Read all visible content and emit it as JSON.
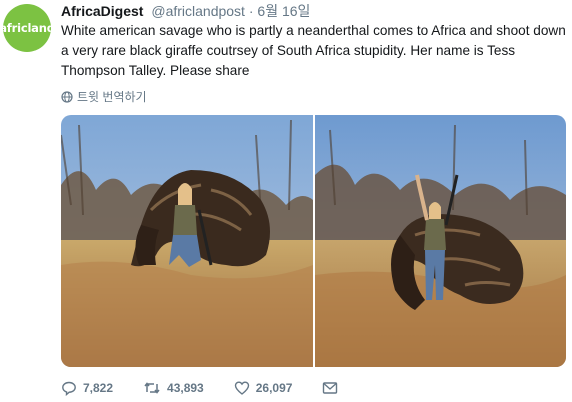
{
  "avatar": {
    "logo_text": "africland",
    "color": "#7cc242"
  },
  "tweet": {
    "display_name": "AfricaDigest",
    "handle": "@africlandpost",
    "separator": "·",
    "date": "6월 16일",
    "text": "White american savage who is partly a neanderthal comes to Africa and shoot down a very rare black giraffe coutrsey of South Africa stupidity. Her name is Tess Thompson Talley. Please share",
    "translate_label": "트윗 번역하기"
  },
  "photos": [
    {
      "description_icon": "photo-left"
    },
    {
      "description_icon": "photo-right"
    }
  ],
  "actions": {
    "replies": "7,822",
    "retweets": "43,893",
    "likes": "26,097"
  },
  "colors": {
    "muted": "#657786",
    "text": "#14171a"
  }
}
